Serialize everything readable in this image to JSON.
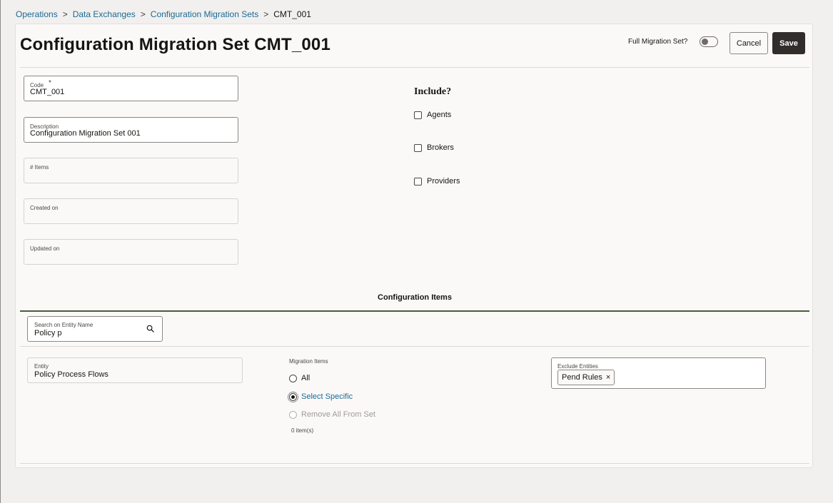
{
  "breadcrumb": {
    "items": [
      "Operations",
      "Data Exchanges",
      "Configuration Migration Sets"
    ],
    "separator": ">",
    "current": "CMT_001"
  },
  "header": {
    "title": "Configuration Migration Set CMT_001",
    "full_migration_label": "Full Migration Set?",
    "full_migration_on": false,
    "cancel_label": "Cancel",
    "save_label": "Save"
  },
  "form": {
    "code": {
      "label": "Code",
      "required_mark": "*",
      "value": "CMT_001"
    },
    "description": {
      "label": "Description",
      "value": "Configuration Migration Set 001"
    },
    "items": {
      "label": "# Items",
      "value": ""
    },
    "created_on": {
      "label": "Created on",
      "value": ""
    },
    "updated_on": {
      "label": "Updated on",
      "value": ""
    }
  },
  "include": {
    "title": "Include?",
    "options": [
      {
        "label": "Agents",
        "checked": false
      },
      {
        "label": "Brokers",
        "checked": false
      },
      {
        "label": "Providers",
        "checked": false
      }
    ]
  },
  "config_items": {
    "title": "Configuration Items",
    "search": {
      "label": "Search on Entity Name",
      "value": "Policy p"
    },
    "entity": {
      "label": "Entity",
      "value": "Policy Process Flows"
    },
    "migration": {
      "label": "Migration Items",
      "options": [
        {
          "label": "All",
          "state": "unchecked"
        },
        {
          "label": "Select Specific",
          "state": "checked"
        },
        {
          "label": "Remove All From Set",
          "state": "disabled"
        }
      ],
      "count_text": "0 item(s)"
    },
    "exclude": {
      "label": "Exclude Entities",
      "chips": [
        "Pend Rules"
      ],
      "chip_remove_glyph": "×"
    }
  },
  "colors": {
    "link": "#1b6a94",
    "primary_button": "#312d2a",
    "section_rule": "#4d5b39",
    "background": "#f1f0ee",
    "card": "#fbf9f8"
  }
}
